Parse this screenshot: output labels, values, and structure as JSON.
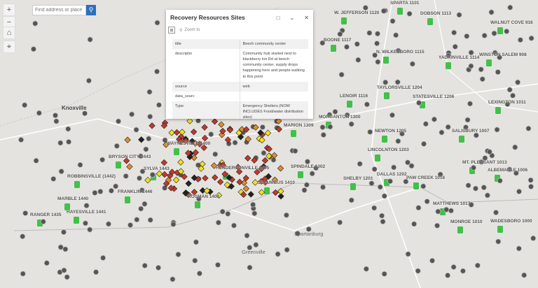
{
  "search": {
    "placeholder": "Find address or place"
  },
  "controls": {
    "zoom_in": "+",
    "zoom_out": "−",
    "home": "⌂",
    "locate": "⌖"
  },
  "popup": {
    "title": "Recovery Resources Sites",
    "zoom_to": "Zoom to",
    "rows": [
      {
        "key": "title",
        "value": "Beech community center"
      },
      {
        "key": "descriptio",
        "value": "Community hub started next to blackberry inn Rd at beech community center, supply drops happening here and people walking to this point"
      },
      {
        "key": "source",
        "value": "web"
      },
      {
        "key": "data_sourc",
        "value": ""
      },
      {
        "key": "Type",
        "value": "Emergency Shelters (NOW INCLUDES Food/water distribution sites)"
      }
    ]
  },
  "map": {
    "cities": [
      "Knoxville",
      "Spartanburg",
      "Greenville"
    ],
    "station_labels": [
      "SPARTA 1101",
      "W. JEFFERSON 1120",
      "DOBSON 1113",
      "WALNUT COVE 916",
      "BOONE 1117",
      "N. WILKESBORO 1115",
      "YADKINVILLE 1114",
      "WINSTON SALEM 908",
      "TAYLORSVILLE 1204",
      "STATESVILLE 1206",
      "LEXINGTON 1011",
      "LENOIR 1116",
      "MORGANTON 1300",
      "SALISBURY 1007",
      "NEWTON 1205",
      "LINCOLNTON 1203",
      "MT. PLEASANT 1013",
      "ALBEMARLE 1006",
      "DALLAS 1202",
      "PAW CREEK 1016",
      "SPINDALE 1302",
      "SHELBY 1201",
      "COLUMBUS 1410",
      "MATTHEWS 1017",
      "MONROE 1010",
      "WADESBORO 1000",
      "MARION 1309",
      "WAYNESVILLE 1400",
      "HENDERSONVILLE 1405",
      "BRYSON CITY 1443",
      "SYLVA 1443",
      "ROBBINSVILLE (1442)",
      "FRANKLIN 1446",
      "ROSMAN 1408",
      "MARBLE 1440",
      "HAYESVILLE 1441",
      "RANGER 1435"
    ]
  },
  "colors": {
    "accent": "#2c6fc0",
    "station": "#43c04a",
    "marker": "#555555",
    "fire": "#c0392b"
  }
}
